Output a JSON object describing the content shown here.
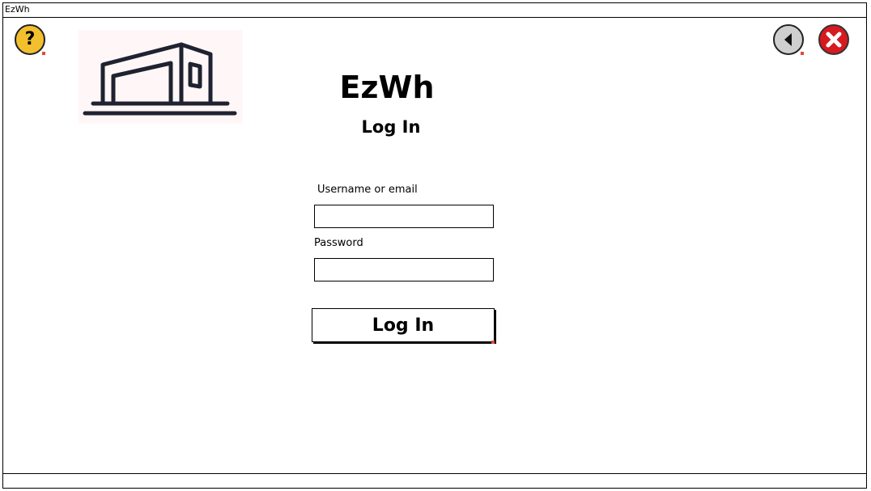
{
  "window": {
    "title": "EzWh"
  },
  "header": {
    "app_name": "EzWh",
    "subtitle": "Log In",
    "help_icon": "question-icon",
    "back_icon": "back-arrow-icon",
    "close_icon": "close-x-icon",
    "logo_icon": "warehouse-icon"
  },
  "form": {
    "username_label": "Username or email",
    "username_value": "",
    "password_label": "Password",
    "password_value": "",
    "submit_label": "Log In"
  },
  "colors": {
    "help_button": "#f2bf2e",
    "back_button": "#cfcfcf",
    "close_button": "#d71920"
  }
}
